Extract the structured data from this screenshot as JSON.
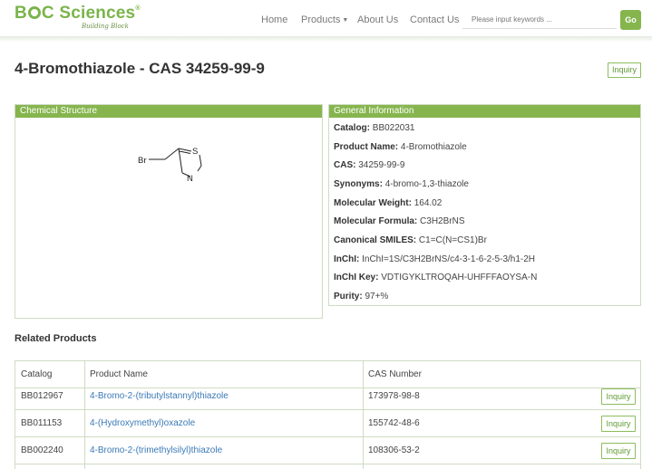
{
  "header": {
    "logo_text_1": "B",
    "logo_text_2": "C Sciences",
    "logo_reg": "®",
    "logo_tagline": "Building Block",
    "nav": {
      "home": "Home",
      "products": "Products",
      "about": "About Us",
      "contact": "Contact Us"
    },
    "search_placeholder": "Please input keywords ...",
    "go_label": "Go"
  },
  "title": "4-Bromothiazole - CAS 34259-99-9",
  "inquiry_label": "Inquiry",
  "chemical_structure": {
    "heading": "Chemical Structure",
    "atoms": {
      "br": "Br",
      "s": "S",
      "n": "N"
    }
  },
  "general_info": {
    "heading": "General Information",
    "rows": [
      {
        "label": "Catalog:",
        "value": "BB022031"
      },
      {
        "label": "Product Name:",
        "value": "4-Bromothiazole"
      },
      {
        "label": "CAS:",
        "value": "34259-99-9"
      },
      {
        "label": "Synonyms:",
        "value": "4-bromo-1,3-thiazole"
      },
      {
        "label": "Molecular Weight:",
        "value": "164.02"
      },
      {
        "label": "Molecular Formula:",
        "value": "C3H2BrNS"
      },
      {
        "label": "Canonical SMILES:",
        "value": "C1=C(N=CS1)Br"
      },
      {
        "label": "InChI:",
        "value": "InChI=1S/C3H2BrNS/c4-3-1-6-2-5-3/h1-2H"
      },
      {
        "label": "InChI Key:",
        "value": "VDTIGYKLTROQAH-UHFFFAOYSA-N"
      },
      {
        "label": "Purity:",
        "value": "97+%"
      }
    ]
  },
  "related": {
    "heading": "Related Products",
    "columns": [
      "Catalog",
      "Product Name",
      "CAS Number"
    ],
    "rows": [
      {
        "catalog": "BB012967",
        "name": "4-Bromo-2-(tributylstannyl)thiazole",
        "cas": "173978-98-8",
        "action": "Inquiry"
      },
      {
        "catalog": "BB011153",
        "name": "4-(Hydroxymethyl)oxazole",
        "cas": "155742-48-6",
        "action": "Inquiry"
      },
      {
        "catalog": "BB002240",
        "name": "4-Bromo-2-(trimethylsilyl)thiazole",
        "cas": "108306-53-2",
        "action": "Inquiry"
      }
    ]
  }
}
